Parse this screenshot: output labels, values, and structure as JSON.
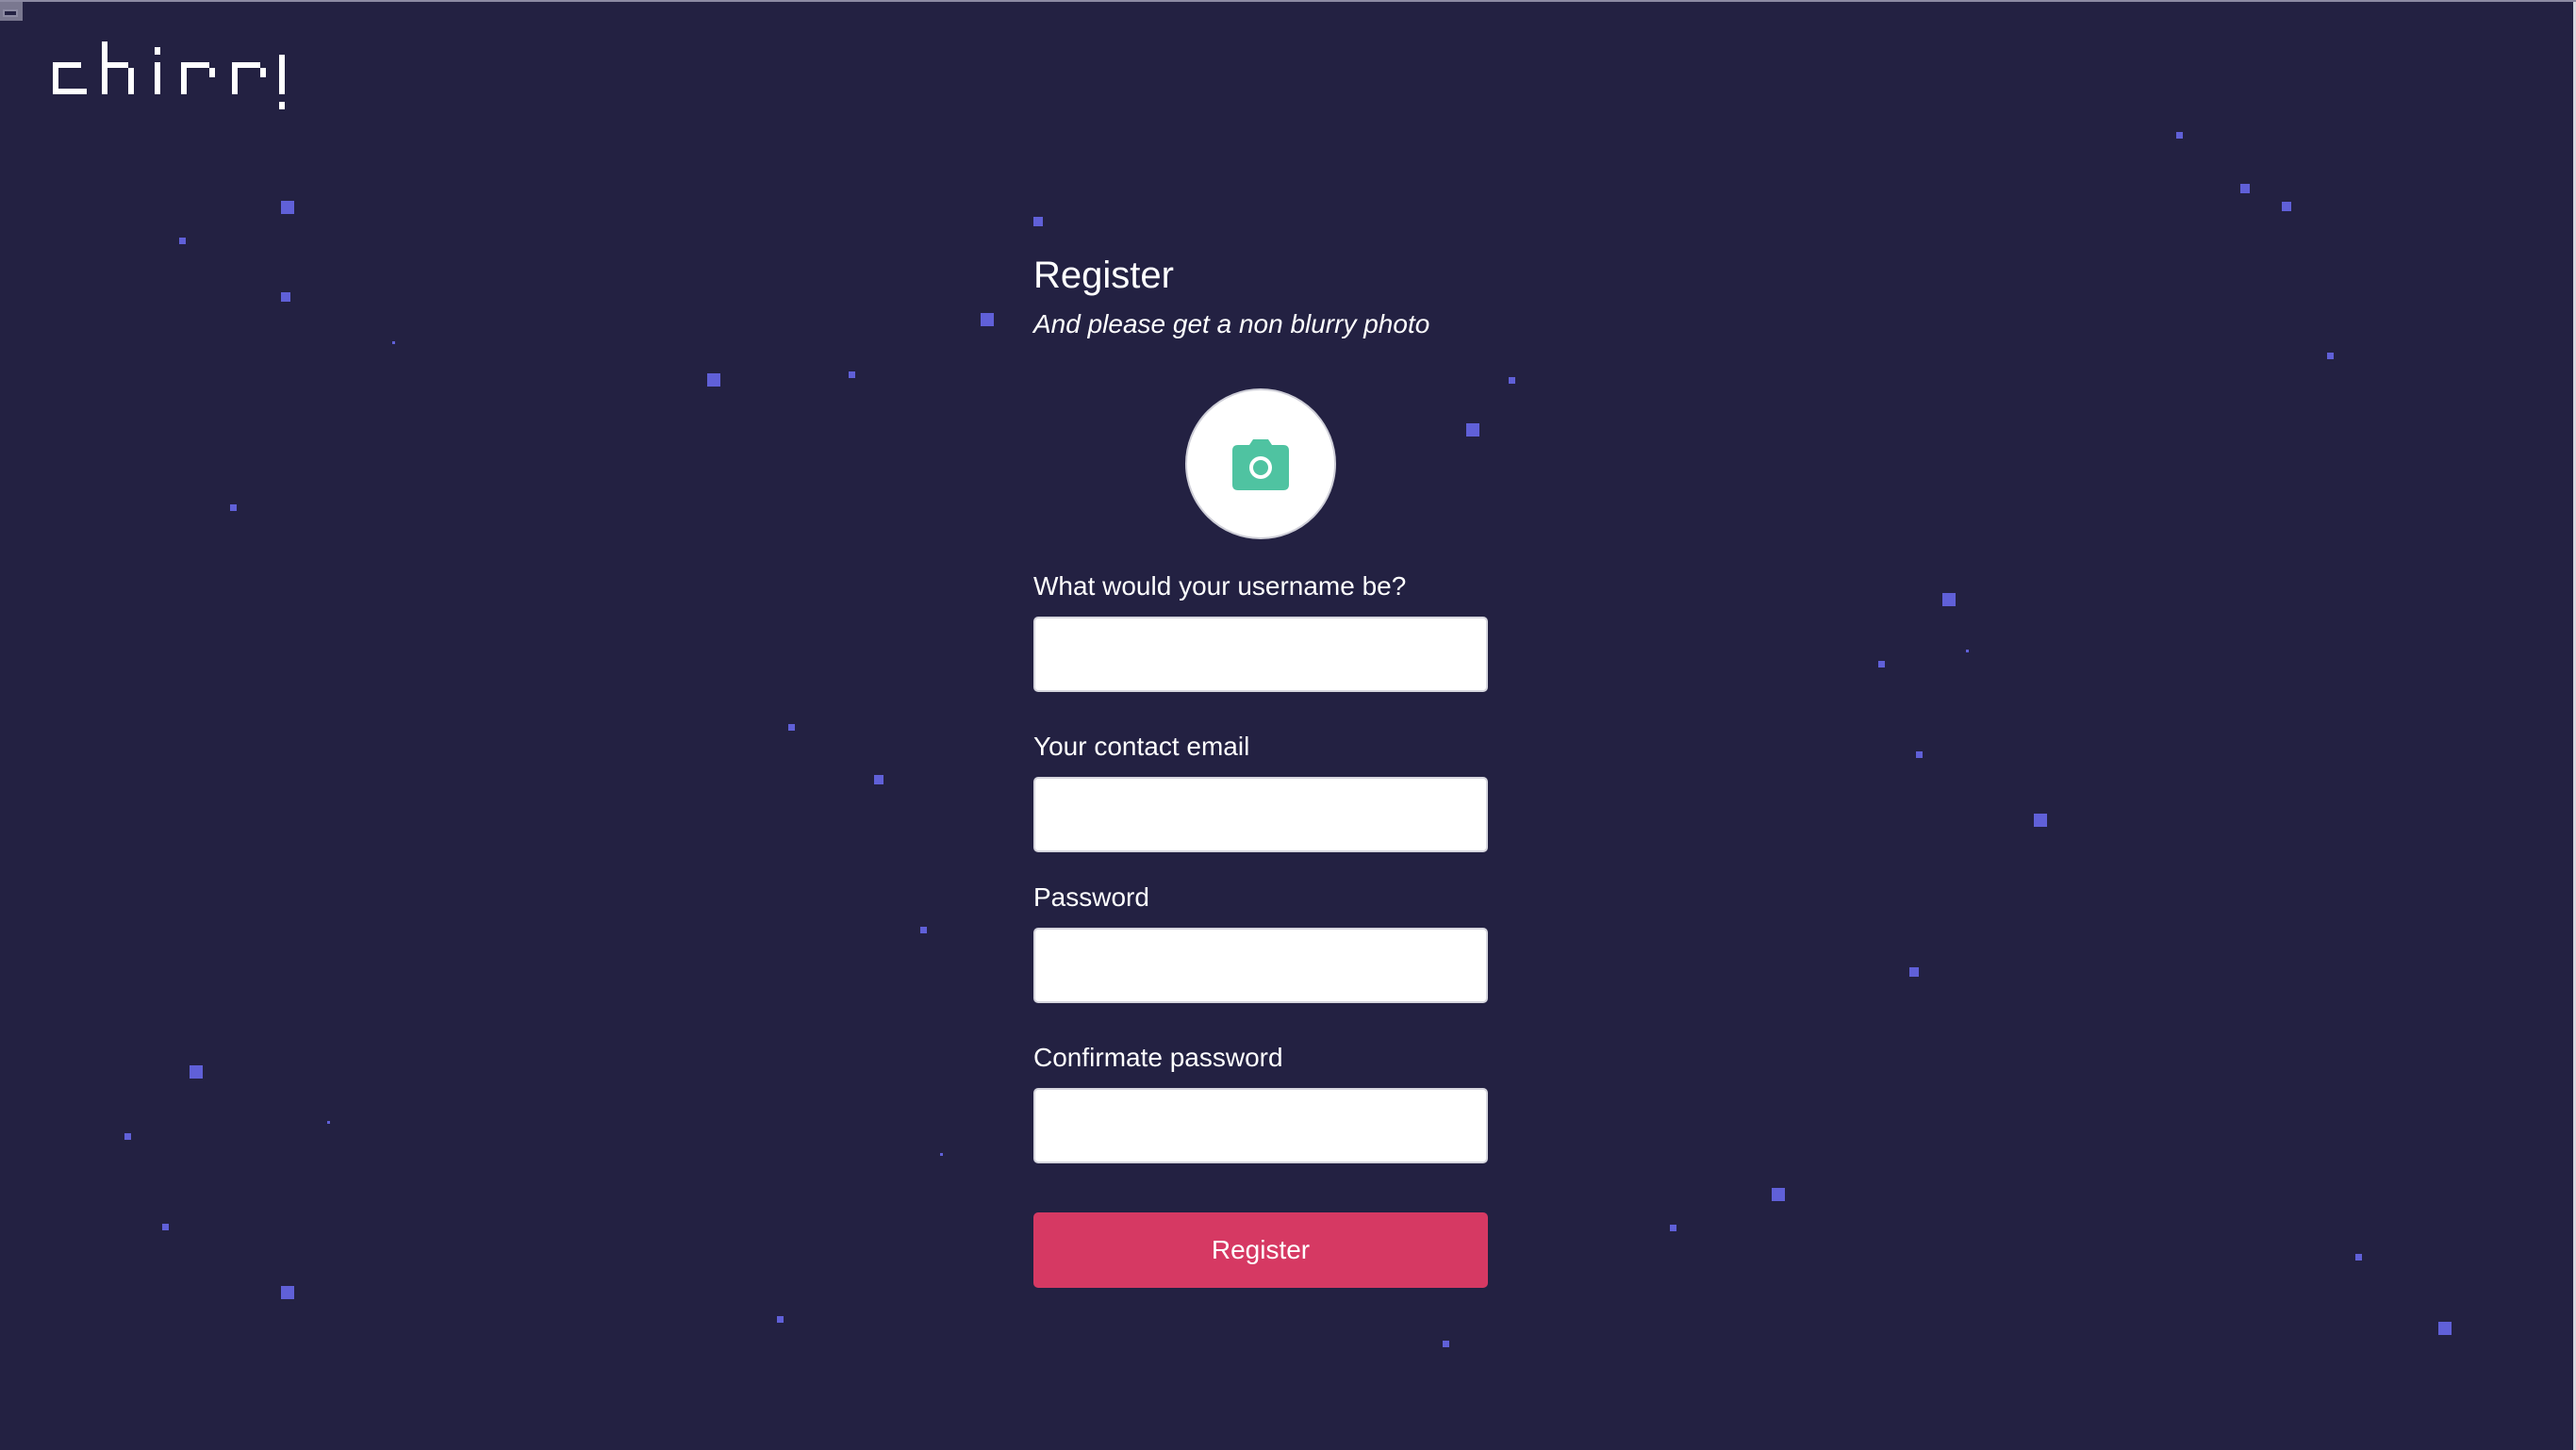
{
  "app": {
    "logo_text": "chirr!"
  },
  "form": {
    "title": "Register",
    "subtitle": "And please get a non blurry photo",
    "photo_icon": "camera-icon",
    "fields": [
      {
        "label": "What would your username be?",
        "value": "",
        "placeholder": ""
      },
      {
        "label": "Your contact email",
        "value": "",
        "placeholder": ""
      },
      {
        "label": "Password",
        "value": "",
        "placeholder": ""
      },
      {
        "label": "Confirmate password",
        "value": "",
        "placeholder": ""
      }
    ],
    "submit_label": "Register"
  },
  "colors": {
    "background": "#232142",
    "accent": "#d63963",
    "star": "#6060d8",
    "camera": "#4fc3a1"
  }
}
